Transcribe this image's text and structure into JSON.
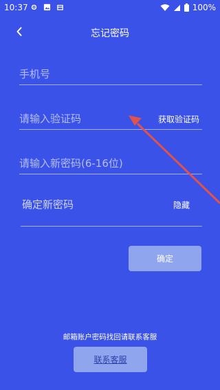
{
  "status_bar": {
    "time": "10:37",
    "left_icons": [
      "settings-icon",
      "image-icon",
      "notification-icon"
    ],
    "right_icons": [
      "wifi-icon",
      "signal-icon",
      "battery-icon"
    ],
    "battery": "100%"
  },
  "nav": {
    "title": "忘记密码",
    "back_icon": "chevron-left-icon"
  },
  "form": {
    "phone_placeholder": "手机号",
    "code_placeholder": "请输入验证码",
    "get_code_label": "获取验证码",
    "new_password_placeholder": "请输入新密码(6-16位)",
    "confirm_password_placeholder": "确定新密码",
    "hide_label": "隐藏",
    "submit_label": "确定"
  },
  "footer": {
    "help_text": "邮箱账户密码找回请联系客服",
    "customer_service_label": "联系客服"
  },
  "colors": {
    "background": "#3a52e8",
    "button": "#8fa6ef",
    "annotation": "#e0524a"
  }
}
